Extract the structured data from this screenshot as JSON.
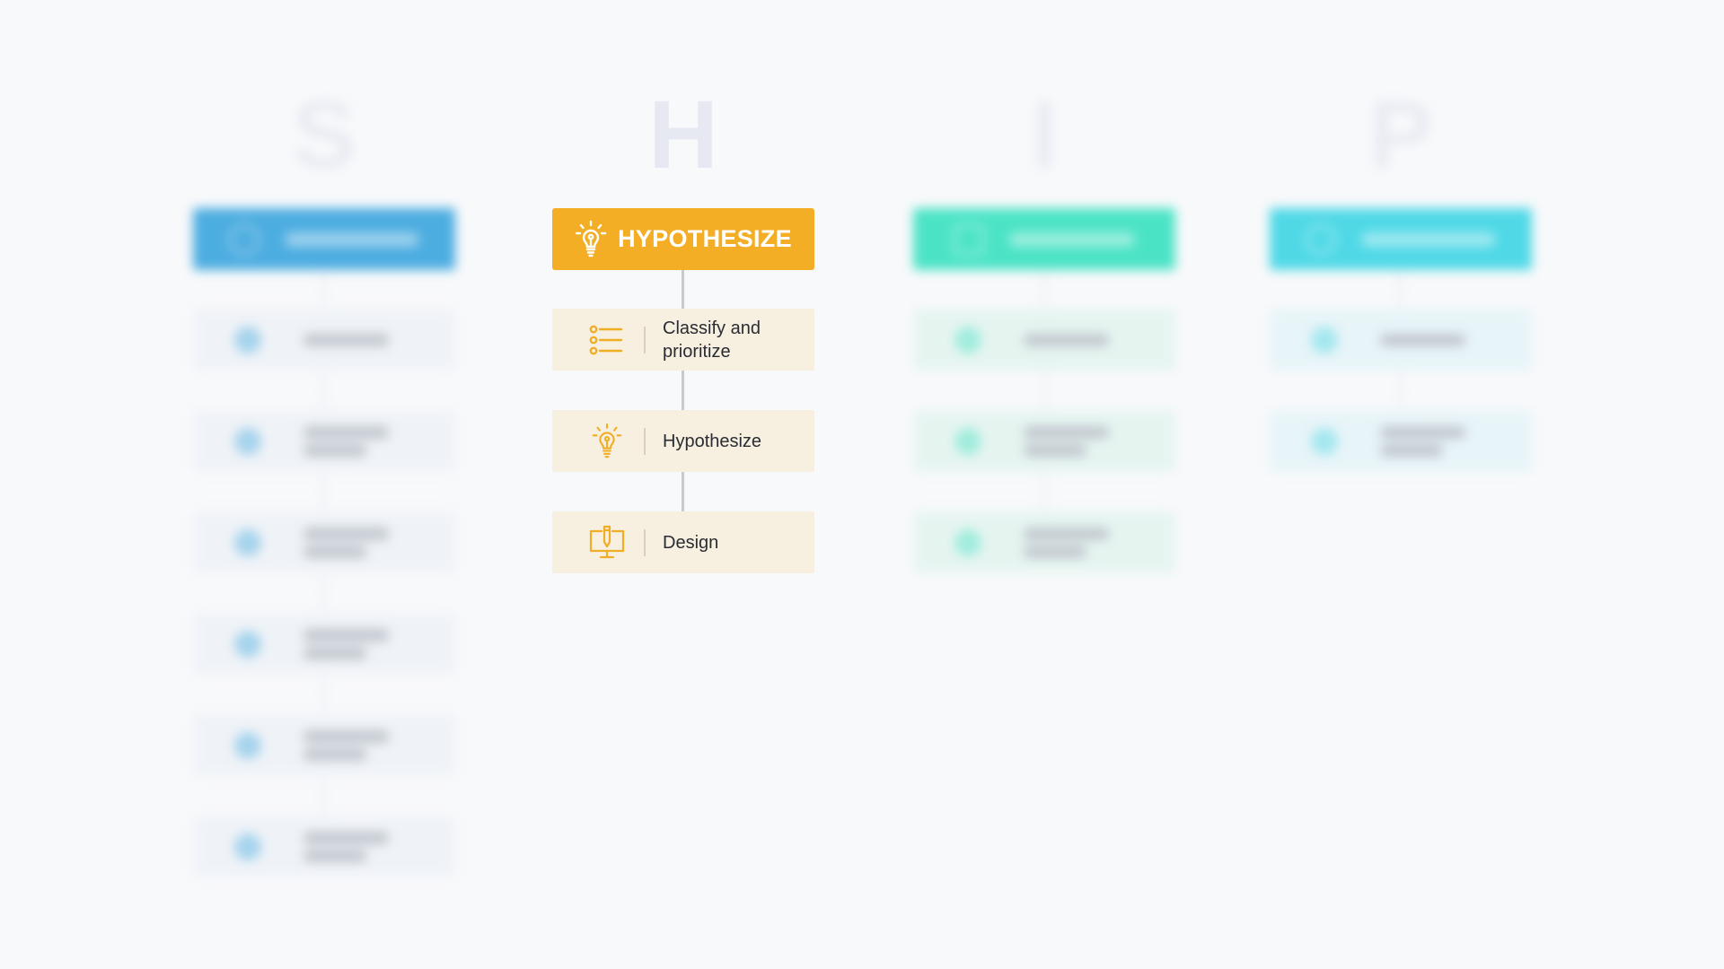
{
  "diagram": {
    "type": "process-flow",
    "focused_column": "hypothesize",
    "columns": [
      {
        "id": "column-1",
        "letter": "S",
        "title": "",
        "state": "blurred",
        "accent": "#2fa0dc",
        "card_bg": "#eef2f7",
        "card_count": 6
      },
      {
        "id": "column-2",
        "letter": "H",
        "title": "HYPOTHESIZE",
        "state": "focused",
        "accent": "#f3ae26",
        "card_bg": "#f7efdf",
        "header_icon": "lightbulb-icon",
        "steps": [
          {
            "label": "Classify and prioritize",
            "icon": "list-icon"
          },
          {
            "label": "Hypothesize",
            "icon": "lightbulb-icon"
          },
          {
            "label": "Design",
            "icon": "monitor-pencil-icon"
          }
        ]
      },
      {
        "id": "column-3",
        "letter": "I",
        "title": "",
        "state": "blurred",
        "accent": "#2ee0bd",
        "card_bg": "#e3f4ef",
        "card_count": 3
      },
      {
        "id": "column-4",
        "letter": "P",
        "title": "",
        "state": "blurred",
        "accent": "#33d3e3",
        "card_bg": "#e5f4f8",
        "card_count": 2
      }
    ]
  }
}
